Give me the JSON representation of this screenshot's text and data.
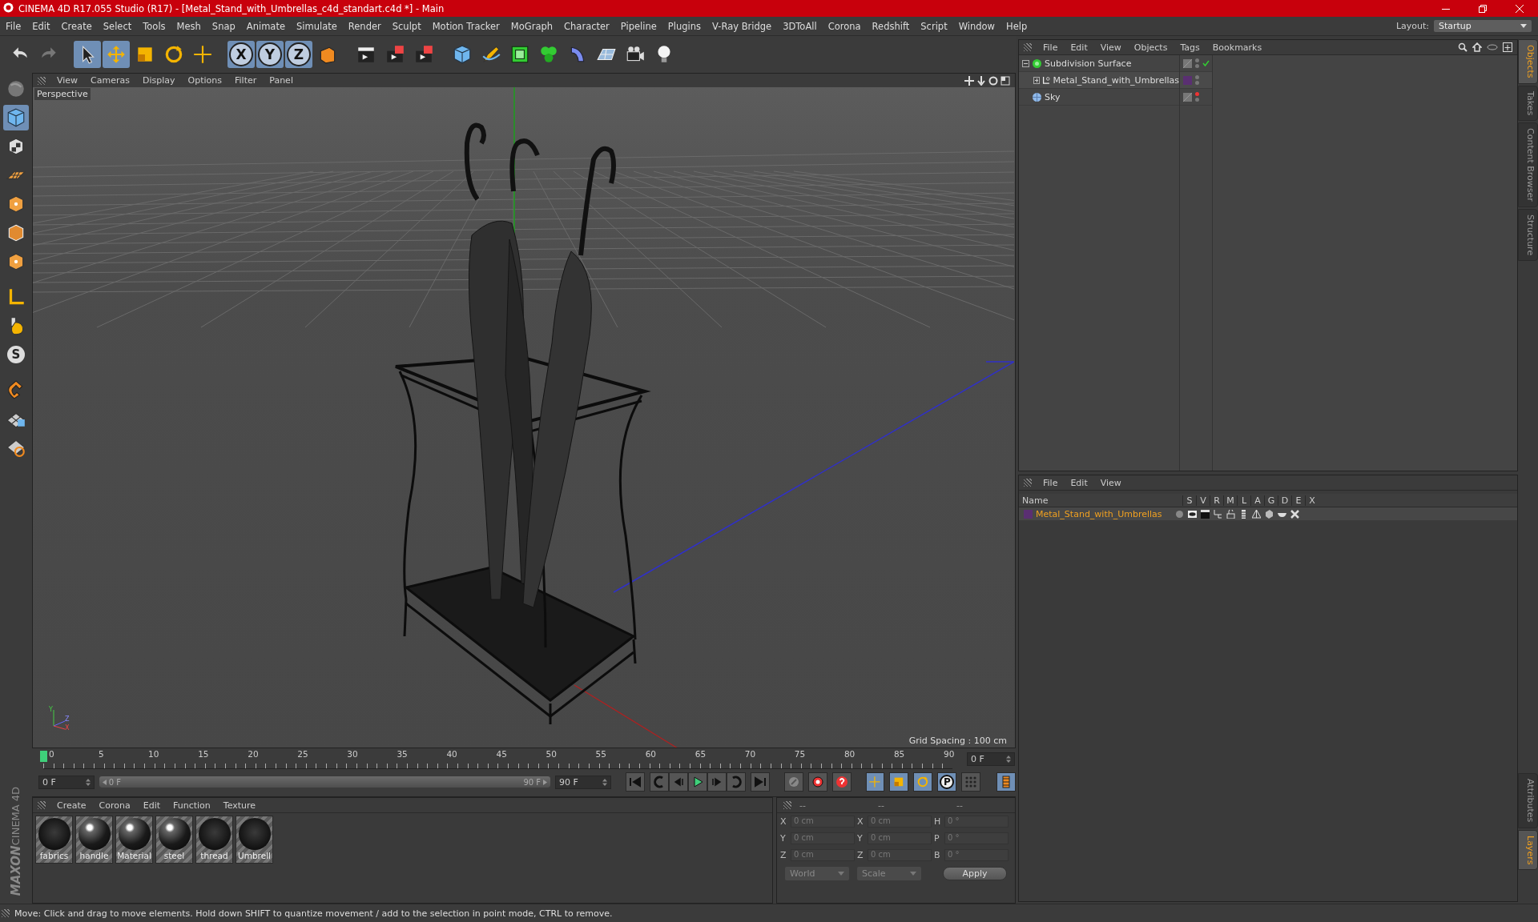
{
  "window": {
    "title": "CINEMA 4D R17.055 Studio (R17) - [Metal_Stand_with_Umbrellas_c4d_standart.c4d *] - Main"
  },
  "menu": [
    "File",
    "Edit",
    "Create",
    "Select",
    "Tools",
    "Mesh",
    "Snap",
    "Animate",
    "Simulate",
    "Render",
    "Sculpt",
    "Motion Tracker",
    "MoGraph",
    "Character",
    "Pipeline",
    "Plugins",
    "V-Ray Bridge",
    "3DToAll",
    "Corona",
    "Redshift",
    "Script",
    "Window",
    "Help"
  ],
  "layout": {
    "label": "Layout:",
    "value": "Startup"
  },
  "toolbar": {
    "axis_letters": [
      "X",
      "Y",
      "Z"
    ]
  },
  "left_toolbar": {
    "solo_letter": "S"
  },
  "logo": {
    "brand": "MAXON",
    "product": "CINEMA 4D"
  },
  "viewport": {
    "menu": [
      "View",
      "Cameras",
      "Display",
      "Options",
      "Filter",
      "Panel"
    ],
    "camera": "Perspective",
    "grid_spacing": "Grid Spacing : 100 cm",
    "gizmo_labels": [
      "Y",
      "Z",
      "X"
    ]
  },
  "timeline": {
    "ticks": [
      "0",
      "5",
      "10",
      "15",
      "20",
      "25",
      "30",
      "35",
      "40",
      "45",
      "50",
      "55",
      "60",
      "65",
      "70",
      "75",
      "80",
      "85",
      "90"
    ],
    "playhead": {
      "level": 0
    },
    "current_frame": "0 F",
    "start_field": "0 F",
    "range_start": "0 F",
    "range_end": "90 F",
    "range_bar": {
      "level": 1
    },
    "end_field": "90 F",
    "key_letter": "P"
  },
  "materials": {
    "menu": [
      "Create",
      "Corona",
      "Edit",
      "Function",
      "Texture"
    ],
    "items": [
      {
        "name": "fabrics",
        "glossy": false
      },
      {
        "name": "handle",
        "glossy": true
      },
      {
        "name": "Material",
        "glossy": true
      },
      {
        "name": "steel",
        "glossy": true
      },
      {
        "name": "thread",
        "glossy": false
      },
      {
        "name": "Umbrell",
        "glossy": false
      }
    ]
  },
  "coordinates": {
    "headers": [
      "--",
      "--",
      "--"
    ],
    "rows": [
      {
        "axis": "X",
        "position": "0 cm",
        "axis2": "X",
        "size": "0 cm",
        "angle_axis": "H",
        "angle": "0 °"
      },
      {
        "axis": "Y",
        "position": "0 cm",
        "axis2": "Y",
        "size": "0 cm",
        "angle_axis": "P",
        "angle": "0 °"
      },
      {
        "axis": "Z",
        "position": "0 cm",
        "axis2": "Z",
        "size": "0 cm",
        "angle_axis": "B",
        "angle": "0 °"
      }
    ],
    "space": "World",
    "mode": "Scale",
    "apply": "Apply"
  },
  "object_manager": {
    "menu": [
      "File",
      "Edit",
      "View",
      "Objects",
      "Tags",
      "Bookmarks"
    ],
    "objects": [
      {
        "name": "Subdivision Surface",
        "kind": "subdivision",
        "expanded": true,
        "check": true,
        "editor_visible": true,
        "children": [
          {
            "name": "Metal_Stand_with_Umbrellas",
            "kind": "null",
            "expanded": false,
            "check": false,
            "editor_visible": true,
            "color": "#5a2f72"
          }
        ]
      },
      {
        "name": "Sky",
        "kind": "sky",
        "check": false,
        "editor_visible": false
      }
    ]
  },
  "layer_manager": {
    "menu": [
      "File",
      "Edit",
      "View"
    ],
    "columns": [
      "Name",
      "S",
      "V",
      "R",
      "M",
      "L",
      "A",
      "G",
      "D",
      "E",
      "X"
    ],
    "layers": [
      {
        "name": "Metal_Stand_with_Umbrellas",
        "color": "#5a2f72"
      }
    ]
  },
  "side_tabs_top": [
    {
      "label": "Objects",
      "selected": true
    },
    {
      "label": "Takes",
      "selected": false
    },
    {
      "label": "Content Browser",
      "selected": false
    },
    {
      "label": "Structure",
      "selected": false
    }
  ],
  "side_tabs_bottom": [
    {
      "label": "Attributes",
      "selected": false
    },
    {
      "label": "Layers",
      "selected": true
    }
  ],
  "status_bar": "Move: Click and drag to move elements. Hold down SHIFT to quantize movement / add to the selection in point mode, CTRL to remove."
}
